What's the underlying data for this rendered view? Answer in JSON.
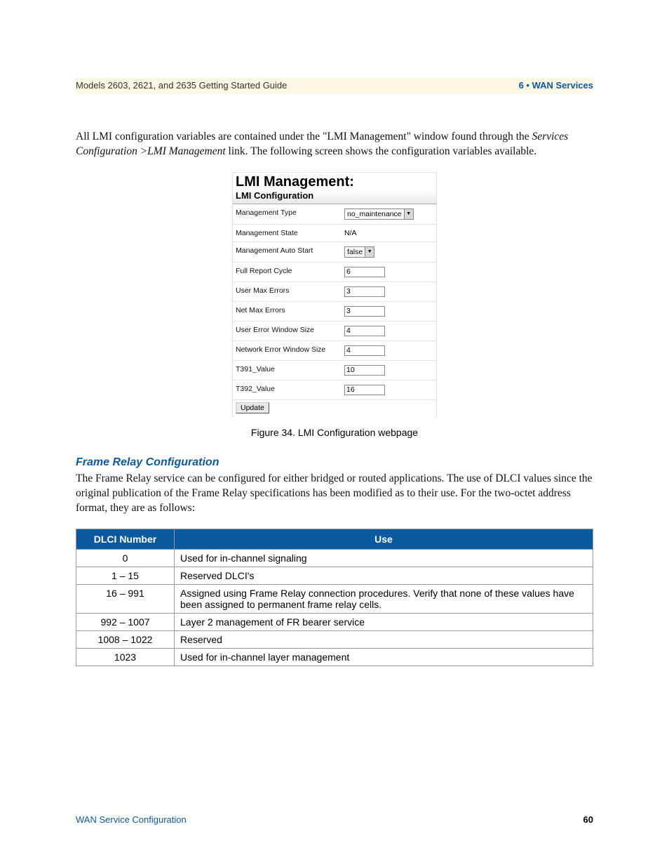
{
  "header": {
    "left": "Models 2603, 2621, and 2635 Getting Started Guide",
    "right": "6 • WAN Services"
  },
  "intro": {
    "part1": "All LMI configuration variables are contained under the \"LMI Management\" window found through the ",
    "italic": "Services Configuration >LMI Management",
    "part2": " link. The following screen shows the configuration variables available."
  },
  "panel": {
    "title": "LMI Management:",
    "subtitle": "LMI Configuration",
    "rows": {
      "mgmt_type_label": "Management Type",
      "mgmt_type_value": "no_maintenance",
      "mgmt_state_label": "Management State",
      "mgmt_state_value": "N/A",
      "auto_start_label": "Management Auto Start",
      "auto_start_value": "false",
      "full_report_label": "Full Report Cycle",
      "full_report_value": "6",
      "user_max_label": "User Max Errors",
      "user_max_value": "3",
      "net_max_label": "Net Max Errors",
      "net_max_value": "3",
      "user_win_label": "User Error Window Size",
      "user_win_value": "4",
      "net_win_label": "Network Error Window Size",
      "net_win_value": "4",
      "t391_label": "T391_Value",
      "t391_value": "10",
      "t392_label": "T392_Value",
      "t392_value": "16"
    },
    "update_button": "Update"
  },
  "figure_caption": "Figure 34. LMI Configuration webpage",
  "section": {
    "heading": "Frame Relay Configuration",
    "body": "The Frame Relay service can be configured for either bridged or routed applications. The use of DLCI values since the original publication of the Frame Relay specifications has been modified as to their use. For the two-octet address format, they are as follows:"
  },
  "table": {
    "headers": {
      "col1": "DLCI Number",
      "col2": "Use"
    },
    "rows": [
      {
        "num": "0",
        "use": "Used for in-channel signaling"
      },
      {
        "num": "1 – 15",
        "use": "Reserved DLCI's"
      },
      {
        "num": "16 – 991",
        "use": "Assigned using Frame Relay connection procedures.  Verify that none of these values have been assigned to permanent frame relay cells."
      },
      {
        "num": "992 – 1007",
        "use": "Layer 2 management of FR bearer service"
      },
      {
        "num": "1008 – 1022",
        "use": "Reserved"
      },
      {
        "num": "1023",
        "use": "Used for in-channel layer management"
      }
    ]
  },
  "footer": {
    "left": "WAN Service Configuration",
    "right": "60"
  }
}
